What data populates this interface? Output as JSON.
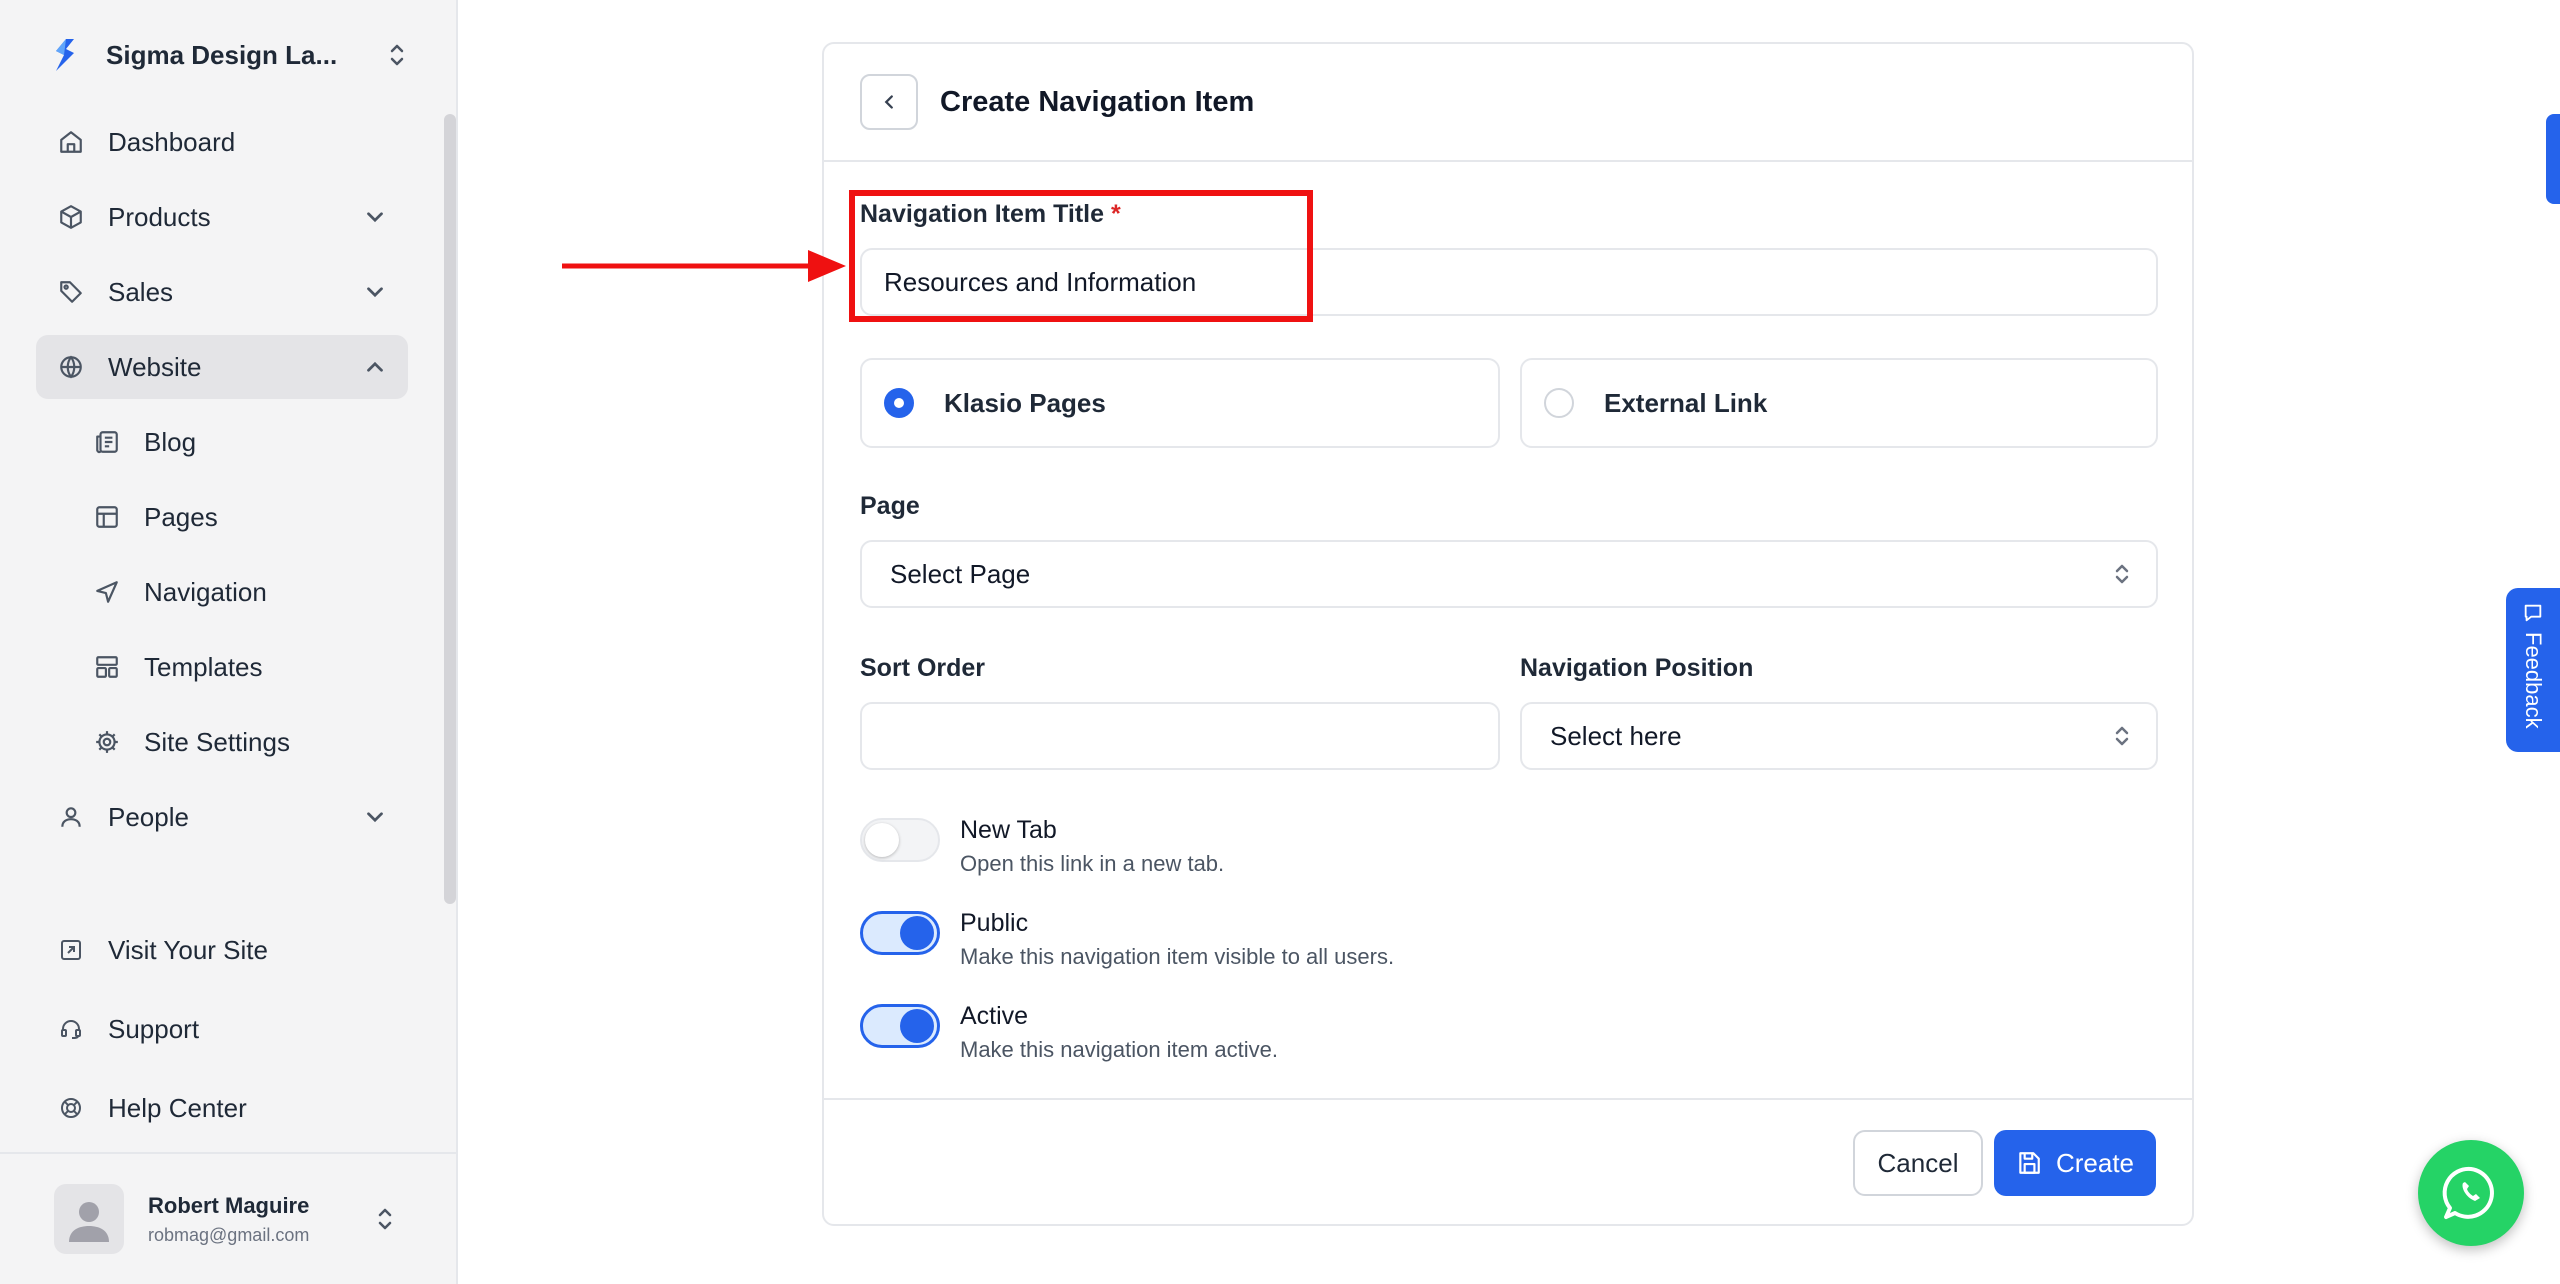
{
  "sidebar": {
    "org_name": "Sigma Design La...",
    "nav": [
      {
        "label": "Dashboard",
        "icon": "home-icon"
      },
      {
        "label": "Products",
        "icon": "box-icon"
      },
      {
        "label": "Sales",
        "icon": "tag-icon"
      },
      {
        "label": "Website",
        "icon": "globe-icon"
      }
    ],
    "website_sub": [
      {
        "label": "Blog",
        "icon": "newspaper-icon"
      },
      {
        "label": "Pages",
        "icon": "layout-icon"
      },
      {
        "label": "Navigation",
        "icon": "navigation-icon"
      },
      {
        "label": "Templates",
        "icon": "template-icon"
      },
      {
        "label": "Site Settings",
        "icon": "gear-icon"
      }
    ],
    "people_label": "People",
    "bottom_links": [
      {
        "label": "Visit Your Site",
        "icon": "external-link-icon"
      },
      {
        "label": "Support",
        "icon": "headset-icon"
      },
      {
        "label": "Help Center",
        "icon": "lifebuoy-icon"
      }
    ],
    "user": {
      "name": "Robert Maguire",
      "email": "robmag@gmail.com"
    }
  },
  "form": {
    "title": "Create Navigation Item",
    "title_field": {
      "label": "Navigation Item Title",
      "required_mark": "*",
      "value": "Resources and Information"
    },
    "link_type": {
      "options": [
        "Klasio Pages",
        "External Link"
      ],
      "selected": "Klasio Pages"
    },
    "page": {
      "label": "Page",
      "placeholder": "Select Page"
    },
    "sort_order": {
      "label": "Sort Order",
      "value": ""
    },
    "nav_position": {
      "label": "Navigation Position",
      "placeholder": "Select here"
    },
    "toggles": [
      {
        "title": "New Tab",
        "desc": "Open this link in a new tab.",
        "on": false
      },
      {
        "title": "Public",
        "desc": "Make this navigation item visible to all users.",
        "on": true
      },
      {
        "title": "Active",
        "desc": "Make this navigation item active.",
        "on": true
      }
    ],
    "cancel_label": "Cancel",
    "create_label": "Create"
  },
  "widgets": {
    "feedback_label": "Feedback"
  },
  "colors": {
    "accent": "#2563eb",
    "annotation": "#ef1111",
    "whatsapp": "#25d366"
  }
}
